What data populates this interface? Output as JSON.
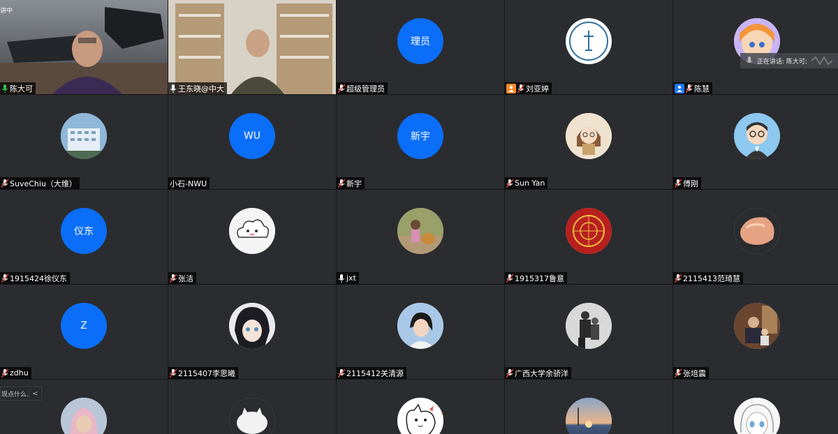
{
  "status": {
    "speaking_label": "正在讲话: 陈大可;",
    "left_hint": "现点什么...",
    "top_left_hint": "讲中",
    "side_chevron": "<"
  },
  "participants": [
    {
      "name": "陈大可",
      "kind": "video",
      "mic": "on",
      "active": true
    },
    {
      "name": "王东晓@中大",
      "kind": "video",
      "mic": "on"
    },
    {
      "name": "超级管理员",
      "kind": "initials",
      "initials": "理员",
      "mic": "muted"
    },
    {
      "name": "刘亚婷",
      "kind": "image",
      "image": "school-seal",
      "mic": "muted",
      "role": "orange"
    },
    {
      "name": "陈慧",
      "kind": "image",
      "image": "anime-girl",
      "mic": "muted",
      "role": "blue"
    },
    {
      "name": "SuveChiu（大维）",
      "kind": "image",
      "image": "building",
      "mic": "muted"
    },
    {
      "name": "小石-NWU",
      "kind": "initials",
      "initials": "WU",
      "mic": "none"
    },
    {
      "name": "新宇",
      "kind": "initials",
      "initials": "新宇",
      "mic": "muted"
    },
    {
      "name": "Sun Yan",
      "kind": "image",
      "image": "cartoon-girl",
      "mic": "muted"
    },
    {
      "name": "傅刚",
      "kind": "image",
      "image": "cartoon-man",
      "mic": "muted"
    },
    {
      "name": "1915424徐仪东",
      "kind": "initials",
      "initials": "仪东",
      "mic": "muted"
    },
    {
      "name": "张洁",
      "kind": "image",
      "image": "cloud",
      "mic": "muted"
    },
    {
      "name": "jxt",
      "kind": "image",
      "image": "child-photo",
      "mic": "on"
    },
    {
      "name": "1915317鲁意",
      "kind": "image",
      "image": "red-emblem",
      "mic": "muted"
    },
    {
      "name": "2115413范琦慧",
      "kind": "image",
      "image": "stone",
      "mic": "muted"
    },
    {
      "name": "zdhu",
      "kind": "initials",
      "initials": "Z",
      "mic": "muted"
    },
    {
      "name": "2115407李思曦",
      "kind": "image",
      "image": "anime-boy",
      "mic": "muted"
    },
    {
      "name": "2115412关清源",
      "kind": "image",
      "image": "woman-photo",
      "mic": "muted"
    },
    {
      "name": "广西大学余骄洋",
      "kind": "image",
      "image": "people-bw",
      "mic": "muted"
    },
    {
      "name": "张培震",
      "kind": "image",
      "image": "man-photo",
      "mic": "muted"
    },
    {
      "name": "",
      "kind": "image",
      "image": "hijab-woman",
      "mic": "none"
    },
    {
      "name": "",
      "kind": "image",
      "image": "white-cat",
      "mic": "none"
    },
    {
      "name": "",
      "kind": "image",
      "image": "sketch-dog",
      "mic": "none"
    },
    {
      "name": "",
      "kind": "image",
      "image": "sunset",
      "mic": "none"
    },
    {
      "name": "",
      "kind": "image",
      "image": "anime-sketch",
      "mic": "none"
    }
  ]
}
